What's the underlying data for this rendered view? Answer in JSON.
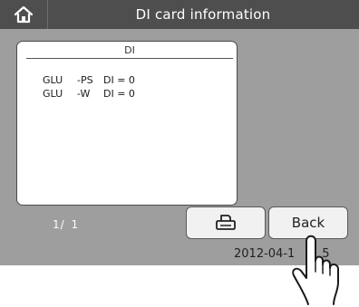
{
  "header": {
    "title": "DI card information",
    "home_icon": "home-icon"
  },
  "panel": {
    "header": "DI",
    "rows": [
      {
        "name": "GLU",
        "type": "-PS",
        "value": "DI = 0"
      },
      {
        "name": "GLU",
        "type": "-W",
        "value": "DI = 0"
      }
    ]
  },
  "footer": {
    "page": "1/ 1",
    "print_icon": "printer-icon",
    "back_label": "Back",
    "datetime": "2012-04-1",
    "datetime_tail": "5"
  },
  "colors": {
    "screen": "#9e9e9e",
    "titlebar": "#4e4e4e"
  }
}
